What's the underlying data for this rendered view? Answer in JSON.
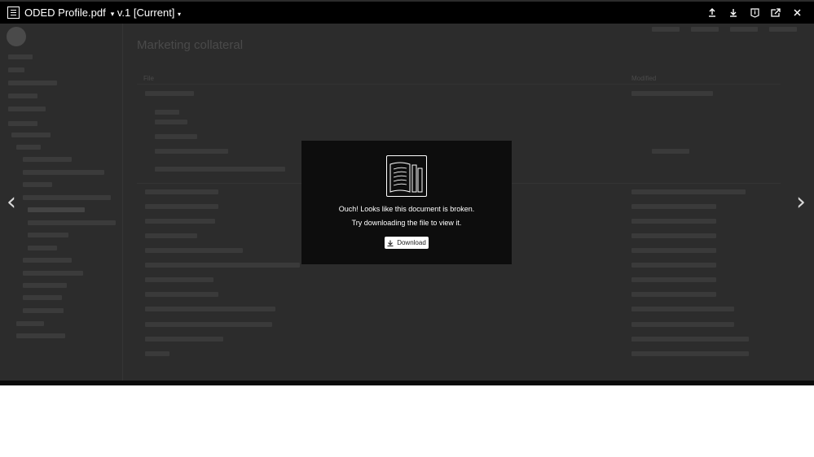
{
  "viewer": {
    "file_name": "ODED Profile.pdf",
    "version_label": "v.1 [Current]",
    "toolbar_icons": [
      "upload-icon",
      "download-icon",
      "info-icon",
      "share-icon",
      "close-icon"
    ]
  },
  "error_dialog": {
    "line1": "Ouch! Looks like this document is broken.",
    "line2": "Try downloading the file to view it.",
    "download_label": "Download"
  },
  "background_page": {
    "page_title": "Marketing collateral",
    "table_headers": [
      "File",
      "Modified"
    ]
  },
  "colors": {
    "topbar": "#000000",
    "overlay": "#2c2c2c",
    "dialog": "#0d0d0d",
    "button": "#ffffff"
  }
}
